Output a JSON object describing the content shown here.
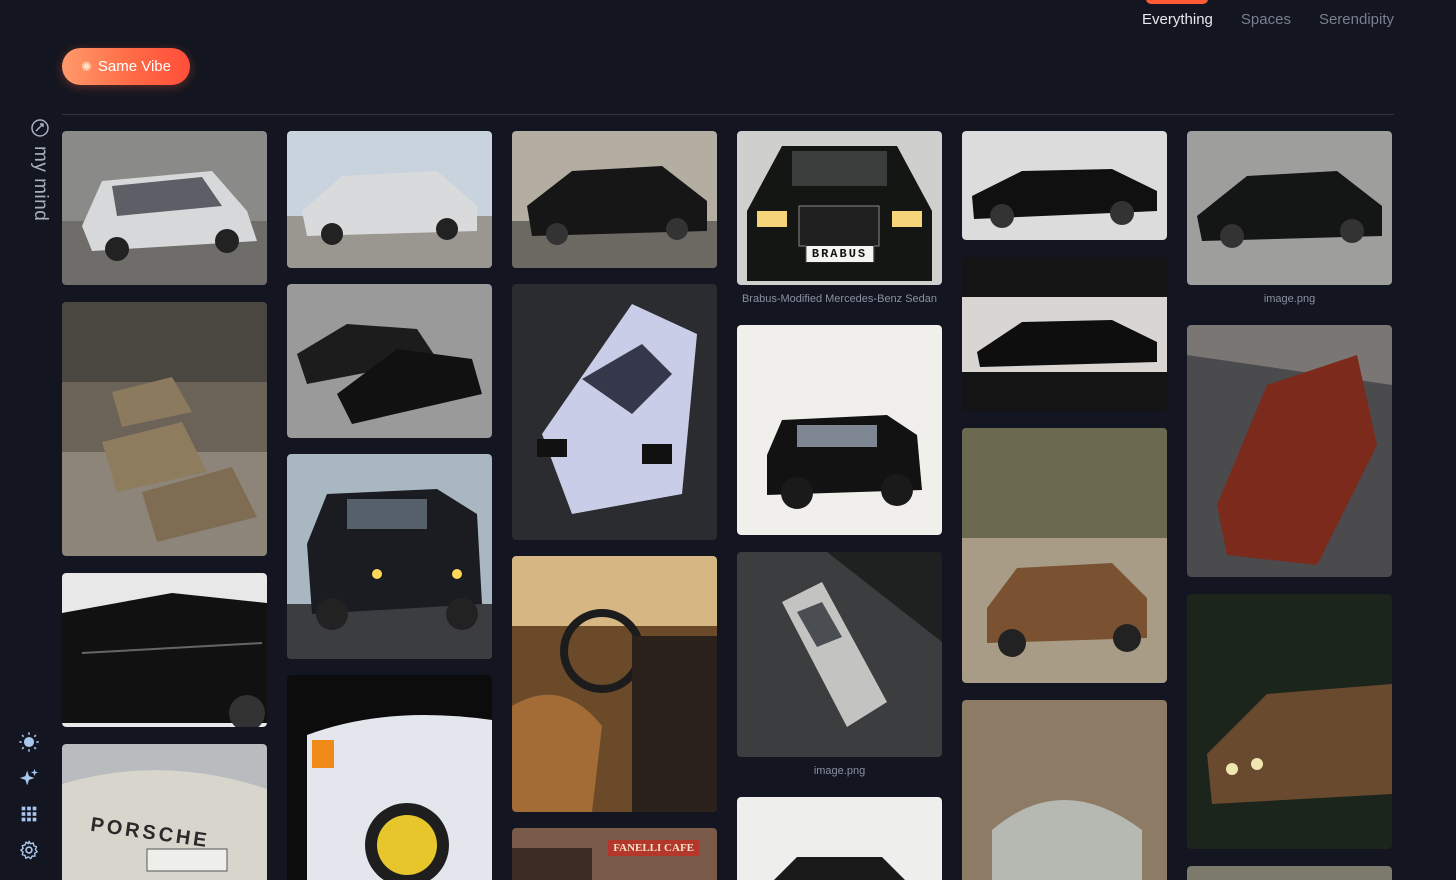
{
  "nav": {
    "tabs": [
      {
        "label": "Everything",
        "active": true
      },
      {
        "label": "Spaces",
        "active": false
      },
      {
        "label": "Serendipity",
        "active": false
      }
    ]
  },
  "filter": {
    "label": "Same Vibe"
  },
  "sidebar": {
    "brand": "my mind",
    "icons": [
      "sun-icon",
      "sparkle-icon",
      "grid-icon",
      "gear-icon"
    ]
  },
  "cards": {
    "brabus_caption": "Brabus-Modified Mercedes-Benz Sedan",
    "image1_caption": "image.png",
    "image2_caption": "image.png",
    "brabus_plate": "BRABUS",
    "cafe_sign": "FANELLI CAFE",
    "porsche_lettering": "PORSCHE"
  },
  "colors": {
    "background": "#131620",
    "accent": "#ff5a36",
    "muted_text": "#7a7f8e"
  }
}
